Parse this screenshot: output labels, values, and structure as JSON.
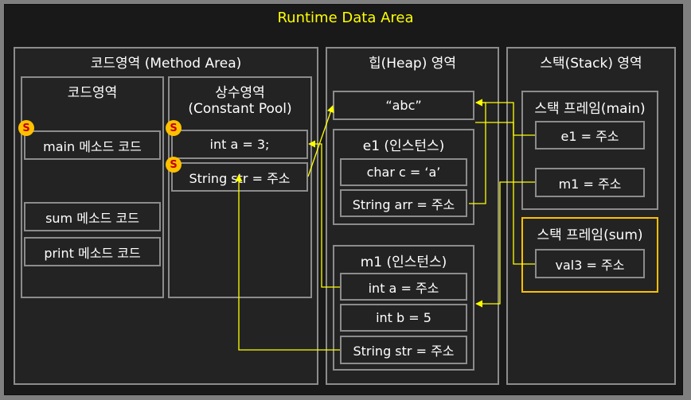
{
  "title": "Runtime Data Area",
  "method_area": {
    "title": "코드영역 (Method Area)",
    "code_area": {
      "title": "코드영역",
      "items": [
        "main 메소드 코드",
        "sum 메소드 코드",
        "print 메소드 코드"
      ]
    },
    "constant_pool": {
      "title_line1": "상수영역",
      "title_line2": "(Constant Pool)",
      "items": [
        "int a = 3;",
        "String str = 주소"
      ]
    }
  },
  "heap": {
    "title": "힙(Heap) 영역",
    "literal": "“abc”",
    "e1": {
      "title": "e1 (인스턴스)",
      "fields": [
        "char c = ‘a’",
        "String arr = 주소"
      ]
    },
    "m1": {
      "title": "m1 (인스턴스)",
      "fields": [
        "int a = 주소",
        "int b = 5",
        "String str = 주소"
      ]
    }
  },
  "stack": {
    "title": "스택(Stack) 영역",
    "main_frame": {
      "title": "스택 프레임(main)",
      "vars": [
        "e1 = 주소",
        "m1 = 주소"
      ]
    },
    "sum_frame": {
      "title": "스택 프레임(sum)",
      "vars": [
        "val3 = 주소"
      ]
    }
  },
  "static_badge": "S",
  "colors": {
    "title_text": "#ffff00",
    "arrow": "#ffff00",
    "border": "#8c8c8c",
    "highlight_border": "#ffc000",
    "badge_fill": "#ffc000",
    "badge_text": "#c00000"
  }
}
